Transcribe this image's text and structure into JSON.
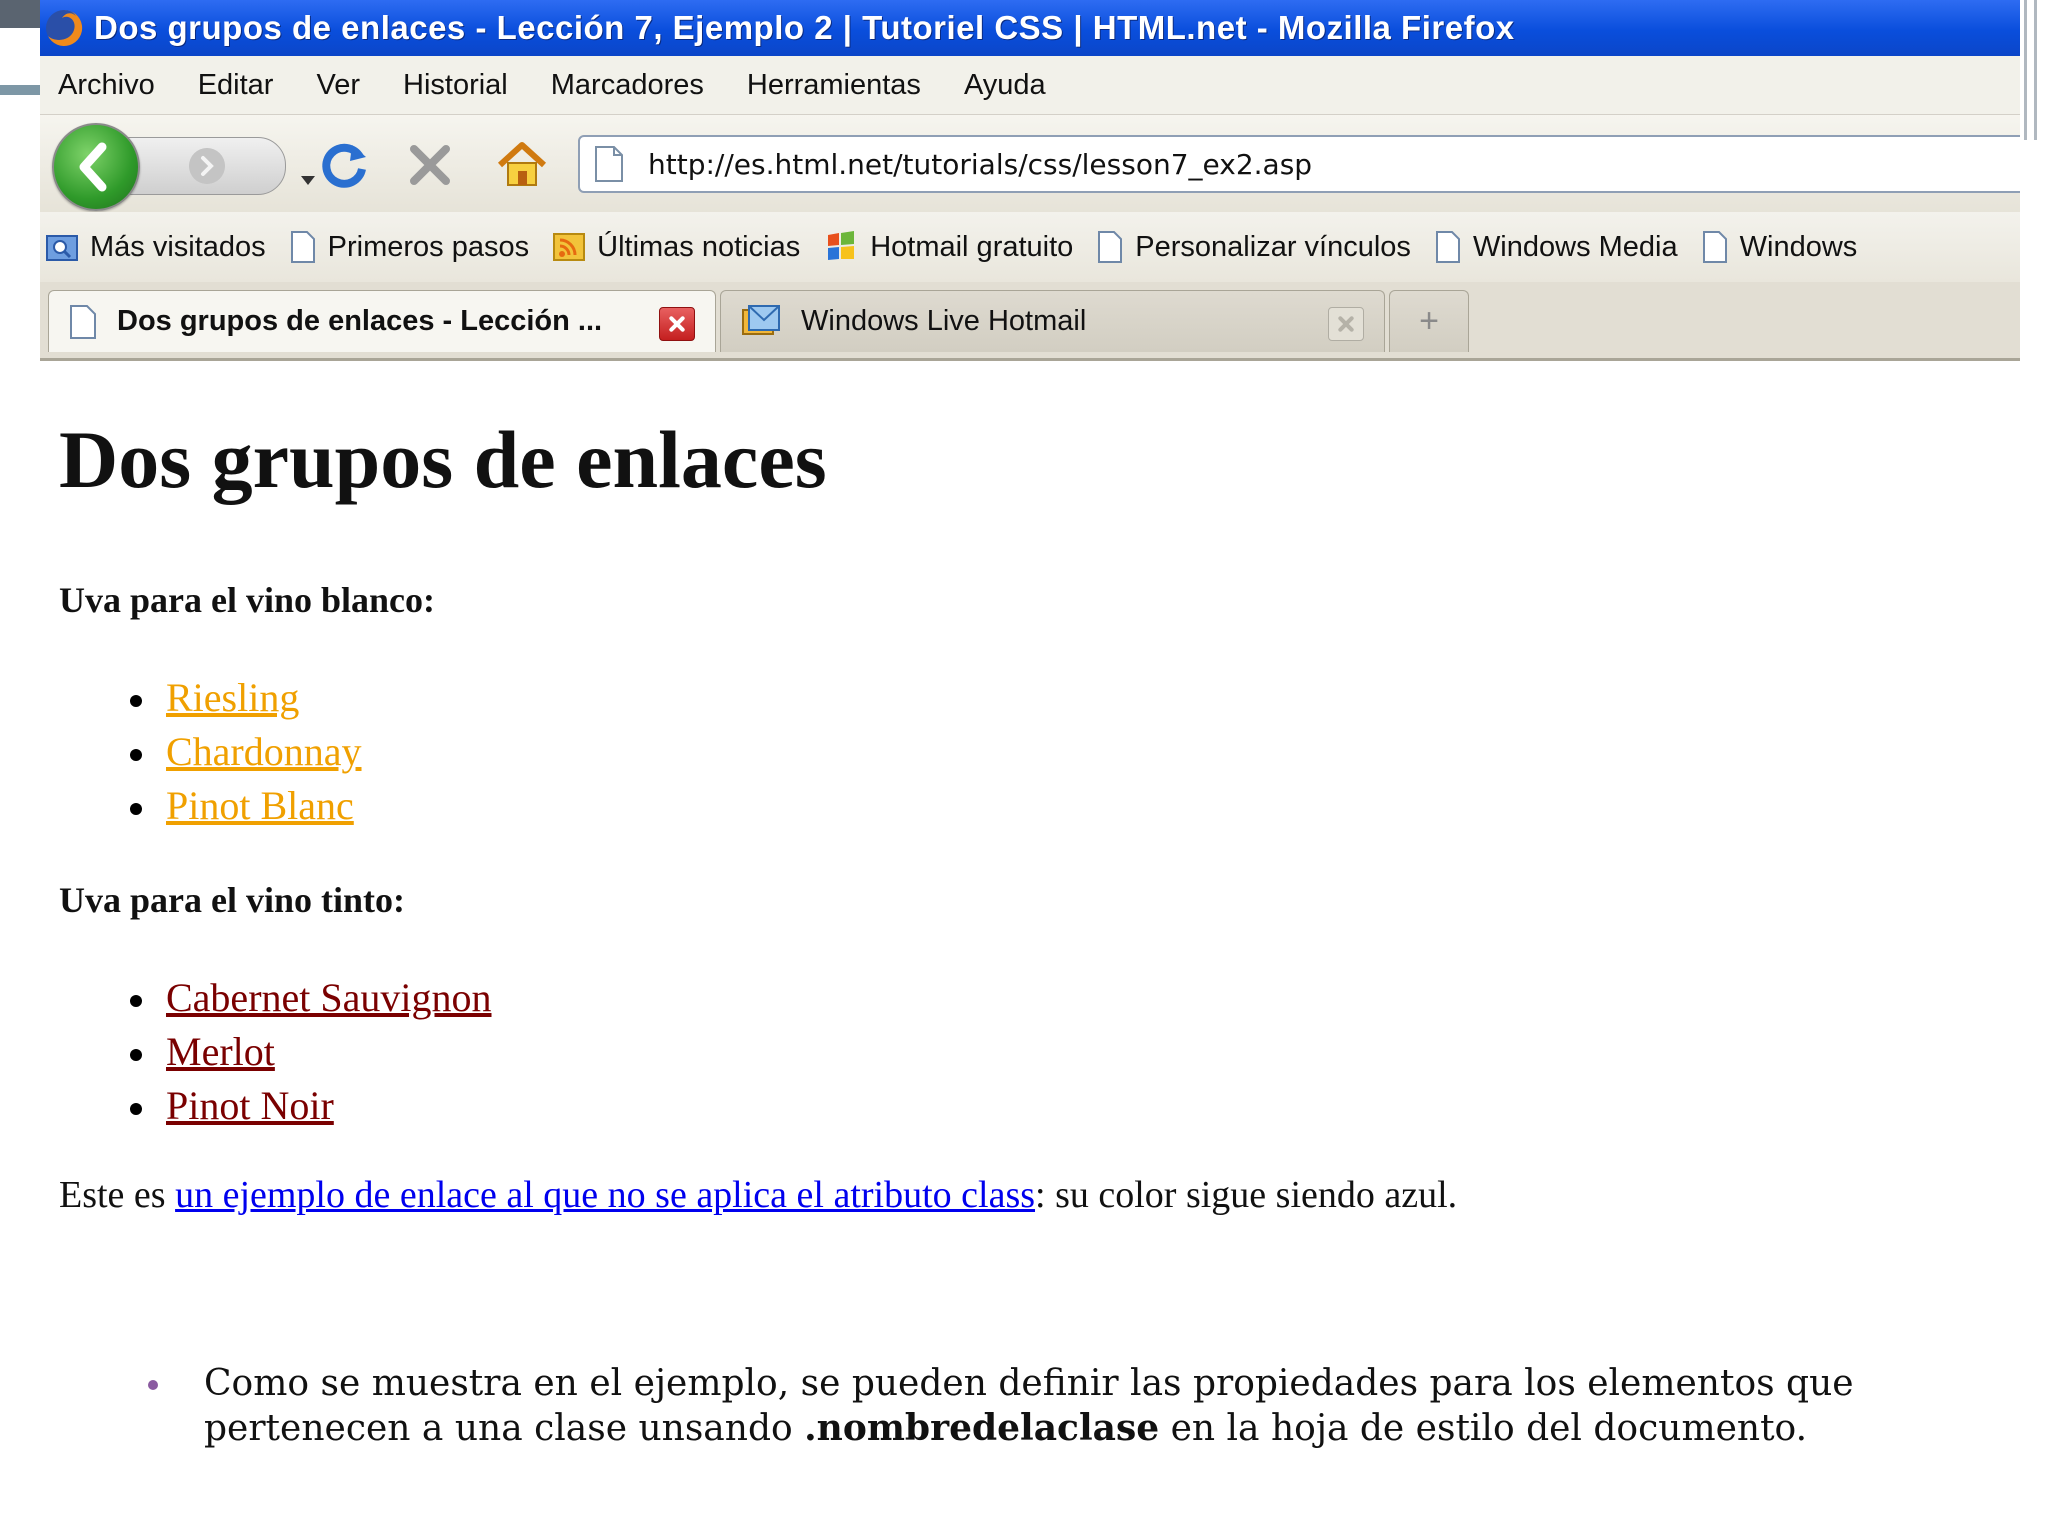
{
  "window": {
    "title": "Dos grupos de enlaces - Lección 7, Ejemplo 2 | Tutoriel CSS | HTML.net - Mozilla Firefox"
  },
  "menu": [
    "Archivo",
    "Editar",
    "Ver",
    "Historial",
    "Marcadores",
    "Herramientas",
    "Ayuda"
  ],
  "address_bar": {
    "url": "http://es.html.net/tutorials/css/lesson7_ex2.asp"
  },
  "bookmarks": [
    "Más visitados",
    "Primeros pasos",
    "Últimas noticias",
    "Hotmail gratuito",
    "Personalizar vínculos",
    "Windows Media",
    "Windows"
  ],
  "tabs": [
    {
      "label": "Dos grupos de enlaces - Lección ..."
    },
    {
      "label": "Windows Live Hotmail"
    }
  ],
  "newtab_label": "+",
  "page": {
    "title": "Dos grupos de enlaces",
    "white_heading": "Uva para el vino blanco:",
    "white_links": [
      "Riesling",
      "Chardonnay",
      "Pinot Blanc"
    ],
    "red_heading": "Uva para el vino tinto:",
    "red_links": [
      "Cabernet Sauvignon",
      "Merlot",
      "Pinot Noir"
    ],
    "note_prefix": "Este es ",
    "note_link": "un ejemplo de enlace al que no se aplica el atributo class",
    "note_suffix": ": su color sigue siendo azul."
  },
  "slide": {
    "bullet_part1": "Como se muestra en el ejemplo, se pueden definir las propiedades para los elementos que pertenecen a una clase unsando ",
    "bullet_bold": ".nombredelaclase",
    "bullet_part2": " en la hoja de estilo del documento."
  },
  "colors": {
    "titlebar": "#0a4edc",
    "white_link": "#f0a000",
    "red_link": "#7a0000",
    "default_link": "#0000ee",
    "slide_bullet": "#8a5aa0"
  },
  "icons": [
    "firefox-icon",
    "back-arrow-icon",
    "forward-arrow-icon",
    "dropdown-arrow-icon",
    "reload-icon",
    "stop-icon",
    "home-icon",
    "page-icon",
    "search-folder-icon",
    "rss-icon",
    "windows-flag-icon",
    "close-icon",
    "hotmail-icon",
    "plus-icon"
  ]
}
